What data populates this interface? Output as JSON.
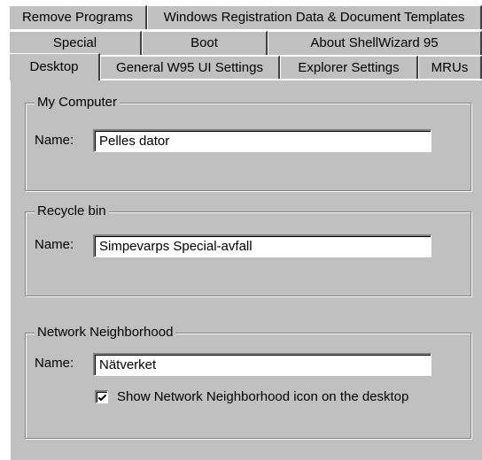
{
  "tabs": {
    "row1": [
      "Remove Programs",
      "Windows Registration Data & Document Templates"
    ],
    "row2": [
      "Special",
      "Boot",
      "About ShellWizard 95"
    ],
    "row3": [
      "Desktop",
      "General W95 UI Settings",
      "Explorer Settings",
      "MRUs"
    ],
    "active": "Desktop"
  },
  "groups": {
    "my_computer": {
      "title": "My Computer",
      "name_label": "Name:",
      "name_value": "Pelles dator"
    },
    "recycle_bin": {
      "title": "Recycle bin",
      "name_label": "Name:",
      "name_value": "Simpevarps Special-avfall"
    },
    "network": {
      "title": "Network Neighborhood",
      "name_label": "Name:",
      "name_value": "Nätverket",
      "checkbox_label": "Show Network Neighborhood icon on the desktop",
      "checkbox_checked": true
    }
  },
  "icons": {
    "checkmark": "checkmark-icon"
  },
  "colors": {
    "face": "#c0c0c0",
    "highlight": "#ffffff",
    "shadow": "#808080",
    "dark_shadow": "#404040"
  }
}
